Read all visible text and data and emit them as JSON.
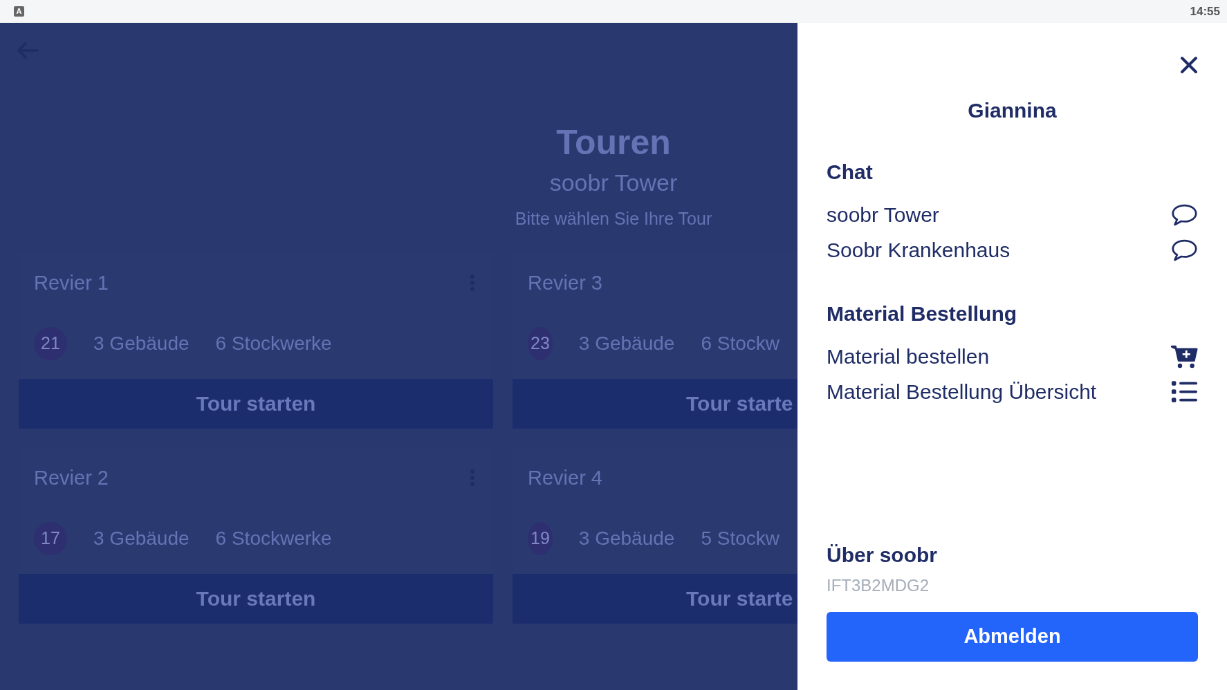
{
  "status_bar": {
    "notification_icon_text": "A",
    "time": "14:55"
  },
  "page": {
    "title": "Touren",
    "subtitle": "soobr Tower",
    "prompt": "Bitte wählen Sie Ihre Tour",
    "cards": [
      {
        "title": "Revier 1",
        "count": "21",
        "buildings": "3 Gebäude",
        "floors": "6 Stockwerke",
        "button": "Tour starten",
        "menu": true
      },
      {
        "title": "Revier 3",
        "count": "23",
        "buildings": "3 Gebäude",
        "floors": "6 Stockw",
        "button": "Tour starte",
        "menu": false
      },
      {
        "title": "Revier 2",
        "count": "17",
        "buildings": "3 Gebäude",
        "floors": "6 Stockwerke",
        "button": "Tour starten",
        "menu": true
      },
      {
        "title": "Revier 4",
        "count": "19",
        "buildings": "3 Gebäude",
        "floors": "5 Stockw",
        "button": "Tour starte",
        "menu": false
      }
    ]
  },
  "panel": {
    "user": "Giannina",
    "sections": [
      {
        "heading": "Chat",
        "items": [
          {
            "label": "soobr Tower",
            "kind": "chat"
          },
          {
            "label": "Soobr Krankenhaus",
            "kind": "chat"
          }
        ]
      },
      {
        "heading": "Material Bestellung",
        "items": [
          {
            "label": "Material bestellen",
            "kind": "cart"
          },
          {
            "label": "Material Bestellung Übersicht",
            "kind": "list"
          }
        ]
      }
    ],
    "about": {
      "heading": "Über soobr",
      "id": "IFT3B2MDG2"
    },
    "logout": "Abmelden"
  }
}
